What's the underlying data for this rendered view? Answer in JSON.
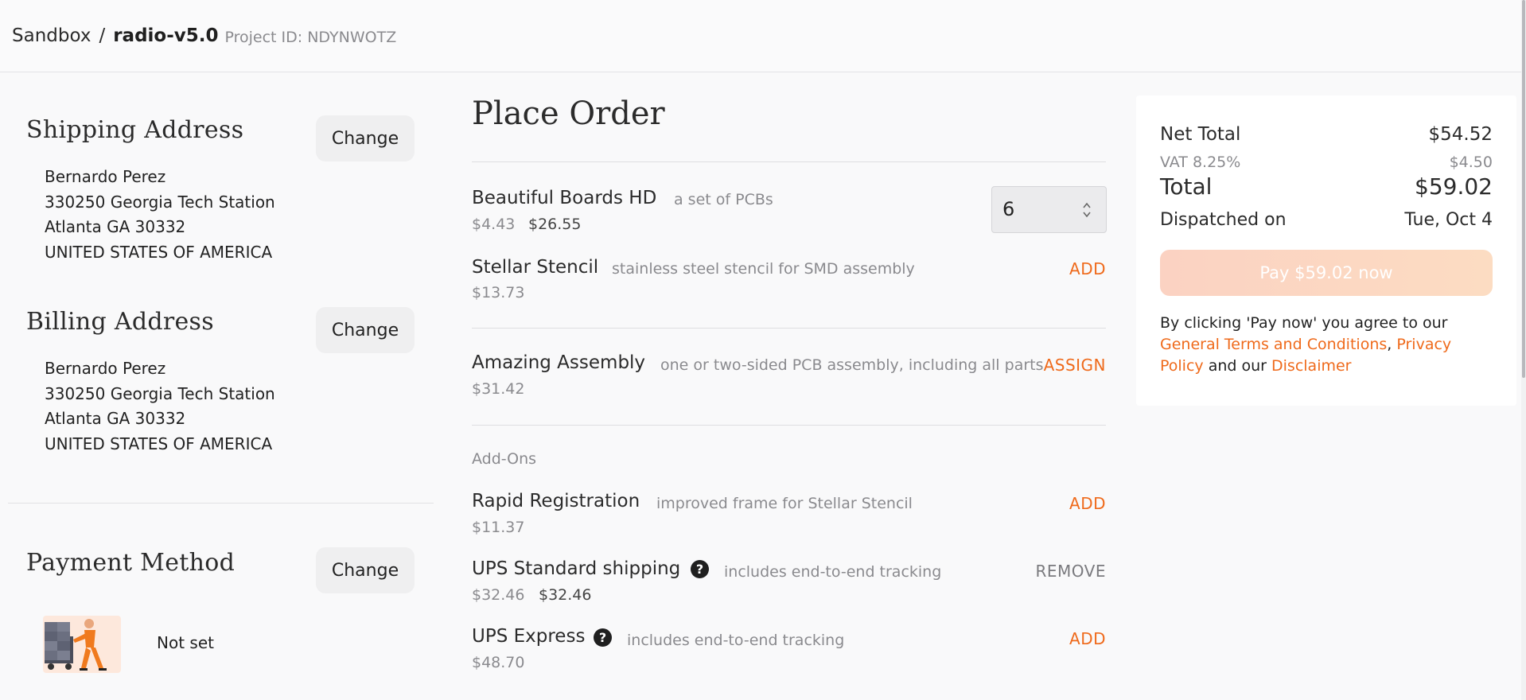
{
  "topbar": {
    "crumb": "Sandbox",
    "separator": "/",
    "project": "radio-v5.0",
    "project_id": "Project ID: NDYNWOTZ"
  },
  "shipping": {
    "title": "Shipping Address",
    "change_label": "Change",
    "lines": [
      "Bernardo Perez",
      "330250 Georgia Tech Station",
      "Atlanta GA 30332",
      "UNITED STATES OF AMERICA"
    ]
  },
  "billing": {
    "title": "Billing Address",
    "change_label": "Change",
    "lines": [
      "Bernardo Perez",
      "330250 Georgia Tech Station",
      "Atlanta GA 30332",
      "UNITED STATES OF AMERICA"
    ]
  },
  "payment": {
    "title": "Payment Method",
    "change_label": "Change",
    "status": "Not set"
  },
  "order": {
    "title": "Place Order",
    "boards": {
      "name": "Beautiful Boards HD",
      "desc": "a set of PCBs",
      "unit_price": "$4.43",
      "total_price": "$26.55",
      "quantity": "6"
    },
    "stencil": {
      "name": "Stellar Stencil",
      "desc": "stainless steel stencil for SMD assembly",
      "price": "$13.73",
      "action": "ADD"
    },
    "assembly": {
      "name": "Amazing Assembly",
      "desc": "one or two-sided PCB assembly, including all parts",
      "price": "$31.42",
      "action": "ASSIGN"
    },
    "addons_label": "Add-Ons",
    "rapid": {
      "name": "Rapid Registration",
      "desc": "improved frame for Stellar Stencil",
      "price": "$11.37",
      "action": "ADD"
    },
    "ups_standard": {
      "name": "UPS Standard shipping",
      "help": "?",
      "desc": "includes end-to-end tracking",
      "price": "$32.46",
      "price_selected": "$32.46",
      "action": "REMOVE"
    },
    "ups_express": {
      "name": "UPS Express",
      "help": "?",
      "desc": "includes end-to-end tracking",
      "price": "$48.70",
      "action": "ADD"
    }
  },
  "summary": {
    "net_label": "Net Total",
    "net_value": "$54.52",
    "vat_label": "VAT 8.25%",
    "vat_value": "$4.50",
    "total_label": "Total",
    "total_value": "$59.02",
    "dispatch_label": "Dispatched on",
    "dispatch_value": "Tue, Oct 4",
    "pay_label": "Pay $59.02 now",
    "terms_prefix": "By clicking 'Pay now' you agree to our",
    "terms_link": "General Terms and Conditions",
    "comma": ",",
    "privacy_link": "Privacy Policy",
    "and_our": "and our",
    "disclaimer_link": "Disclaimer"
  },
  "colors": {
    "accent": "#ef6a1b",
    "background": "#f9f9fa",
    "muted": "#8a8a8e"
  }
}
